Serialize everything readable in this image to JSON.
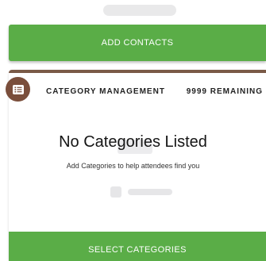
{
  "contacts": {
    "add_button_label": "ADD CONTACTS"
  },
  "category": {
    "header_title": "CATEGORY MANAGEMENT",
    "remaining_label": "9999 REMAINING",
    "badge_icon": "list-icon",
    "empty_title": "No Categories Listed",
    "empty_subtitle": "Add Categories to help attendees find you",
    "select_button_label": "SELECT CATEGORIES"
  },
  "colors": {
    "accent_green": "#5aad47",
    "brand_brown": "#7a4e3b"
  }
}
